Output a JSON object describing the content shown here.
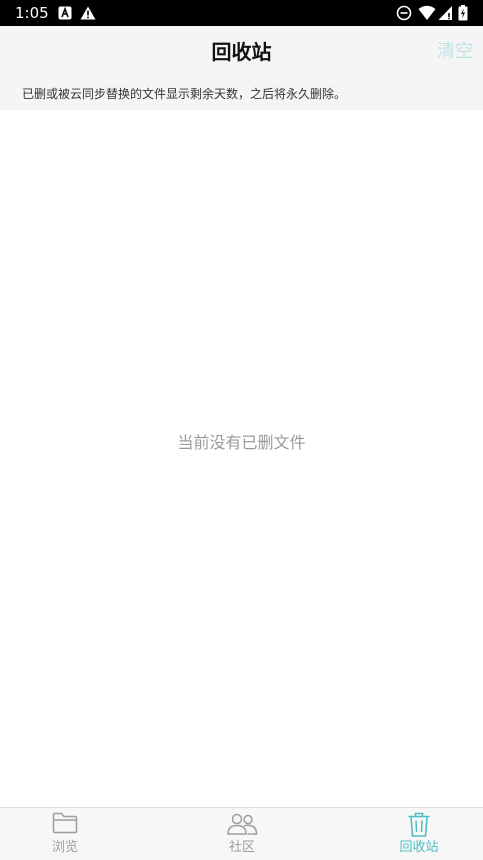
{
  "status_bar": {
    "time": "1:05"
  },
  "header": {
    "title": "回收站",
    "clear_label": "清空",
    "info": "已删或被云同步替换的文件显示剩余天数，之后将永久删除。"
  },
  "main": {
    "empty_message": "当前没有已删文件"
  },
  "bottom_nav": {
    "items": [
      {
        "label": "浏览",
        "icon": "folder-icon",
        "active": false
      },
      {
        "label": "社区",
        "icon": "community-icon",
        "active": false
      },
      {
        "label": "回收站",
        "icon": "trash-icon",
        "active": true
      }
    ]
  },
  "colors": {
    "accent": "#4dbfc4",
    "inactive": "#9e9e9e",
    "clear_disabled": "#bfe4e8"
  }
}
